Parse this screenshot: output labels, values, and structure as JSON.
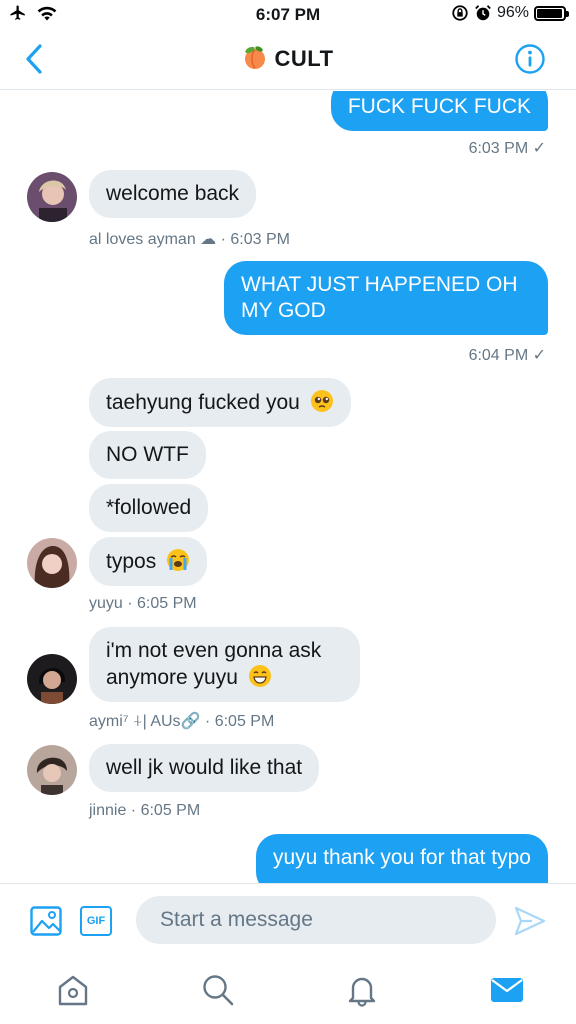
{
  "status_bar": {
    "time": "6:07 PM",
    "battery_text": "96%",
    "battery_level": 0.96,
    "icons": [
      "airplane-icon",
      "wifi-icon",
      "rotation-lock-icon",
      "alarm-icon",
      "battery-icon"
    ]
  },
  "nav": {
    "title": "CULT",
    "title_emoji": "peach",
    "back_icon": "chevron-left-icon",
    "info_icon": "info-icon"
  },
  "messages": [
    {
      "id": "m1",
      "direction": "out",
      "lines": [
        "FUCK FUCK FUCK"
      ]
    },
    {
      "id": "m1meta",
      "text": "6:03 PM ✓"
    },
    {
      "id": "m2",
      "direction": "in",
      "lines": [
        "welcome back"
      ]
    },
    {
      "id": "m2meta",
      "text": "al loves ayman ☁ · 6:03 PM"
    },
    {
      "id": "m3",
      "direction": "out",
      "lines": [
        "WHAT JUST HAPPENED OH",
        "MY GOD"
      ]
    },
    {
      "id": "m3meta",
      "text": "6:04 PM ✓"
    },
    {
      "id": "m4",
      "direction": "in",
      "lines": [
        "taehyung fucked you"
      ],
      "emoji": "pleading-face"
    },
    {
      "id": "m5",
      "direction": "in",
      "lines": [
        "NO WTF"
      ]
    },
    {
      "id": "m6",
      "direction": "in",
      "lines": [
        "*followed"
      ]
    },
    {
      "id": "m7",
      "direction": "in",
      "lines": [
        "typos"
      ],
      "emoji": "loudly-crying-face"
    },
    {
      "id": "m7meta",
      "text": "yuyu · 6:05 PM"
    },
    {
      "id": "m8",
      "direction": "in",
      "lines": [
        "i'm not even gonna ask",
        "anymore yuyu"
      ],
      "emoji": "grinning-face"
    },
    {
      "id": "m8meta",
      "text": "aymi⁷ ⍭| AUs🔗 · 6:05 PM"
    },
    {
      "id": "m9",
      "direction": "in",
      "lines": [
        "well jk would like that"
      ]
    },
    {
      "id": "m9meta",
      "text": "jinnie · 6:05 PM"
    },
    {
      "id": "m10",
      "direction": "out",
      "lines": [
        "yuyu thank you for that typo"
      ]
    }
  ],
  "composer": {
    "placeholder": "Start a message",
    "gif_label": "GIF",
    "image_icon": "image-icon",
    "send_icon": "send-icon"
  },
  "tabbar": {
    "tabs": [
      "home-icon",
      "search-icon",
      "notifications-icon",
      "messages-icon"
    ],
    "active": "messages-icon"
  },
  "colors": {
    "accent": "#1da1f2",
    "bubble_in": "#e6ecf0",
    "meta": "#657786"
  }
}
